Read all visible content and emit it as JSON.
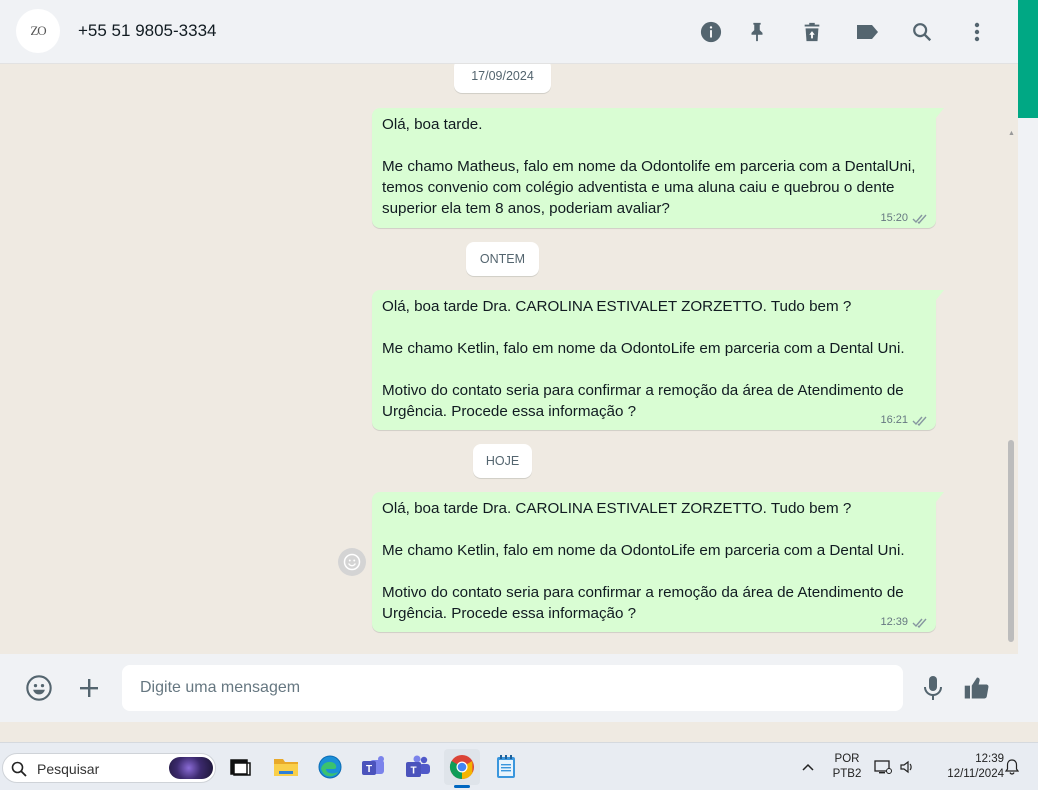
{
  "header": {
    "avatar_text": "ZO",
    "contact_name": "+55 51 9805-3334",
    "icons": [
      "info-icon",
      "pin-icon",
      "delete-icon",
      "label-icon",
      "search-icon",
      "menu-icon"
    ]
  },
  "chat": {
    "date_pills": [
      "17/09/2024",
      "ONTEM",
      "HOJE"
    ],
    "messages": [
      {
        "text": "Olá, boa tarde.\n\nMe chamo Matheus, falo em nome da Odontolife em parceria com a DentalUni, temos convenio com colégio adventista e uma aluna caiu e quebrou o dente superior ela tem 8 anos, poderiam avaliar?",
        "time": "15:20"
      },
      {
        "text": "Olá, boa tarde Dra. CAROLINA ESTIVALET ZORZETTO. Tudo bem ?\n\nMe chamo Ketlin, falo em nome da OdontoLife em parceria com a Dental Uni.\n\nMotivo do contato seria para confirmar a remoção da área de Atendimento de Urgência. Procede essa informação ?",
        "time": "16:21"
      },
      {
        "text": "Olá, boa tarde Dra. CAROLINA ESTIVALET ZORZETTO. Tudo bem ?\n\nMe chamo Ketlin, falo em nome da OdontoLife em parceria com a Dental Uni.\n\nMotivo do contato seria para confirmar a remoção da área de Atendimento de Urgência. Procede essa informação ?",
        "time": "12:39"
      }
    ]
  },
  "composer": {
    "placeholder": "Digite uma mensagem"
  },
  "taskbar": {
    "search_label": "Pesquisar",
    "language_line1": "POR",
    "language_line2": "PTB2",
    "time": "12:39",
    "date": "12/11/2024"
  },
  "colors": {
    "accent": "#00a884",
    "bubble_out": "#d9fdd3",
    "chat_bg": "#efeae2",
    "header_bg": "#f0f2f5",
    "tick_color": "#53bdeb"
  }
}
